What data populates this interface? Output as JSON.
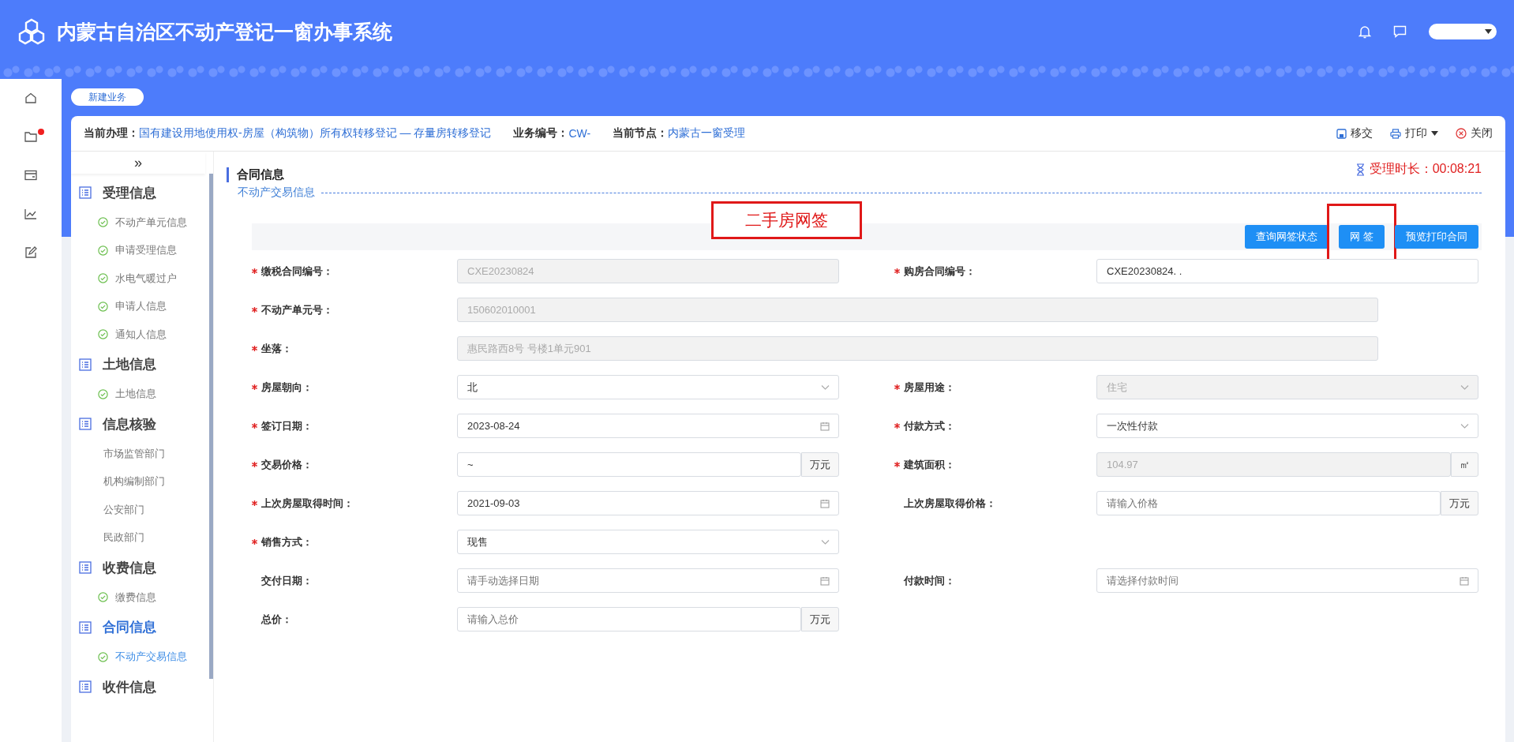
{
  "app": {
    "title": "内蒙古自治区不动产登记一窗办事系统"
  },
  "header_actions": [
    {
      "kind": "bell"
    },
    {
      "kind": "chat"
    }
  ],
  "rail": [
    {
      "kind": "home",
      "badge": false
    },
    {
      "kind": "folder",
      "badge": true
    },
    {
      "kind": "card",
      "badge": false
    },
    {
      "kind": "chart",
      "badge": false
    },
    {
      "kind": "edit",
      "badge": false
    }
  ],
  "page_tab": "新建业务",
  "info_bar": [
    {
      "label": "当前办理：",
      "value": "国有建设用地使用权-房屋（构筑物）所有权转移登记 — 存量房转移登记"
    },
    {
      "label": "业务编号：",
      "value": "CW-"
    },
    {
      "label": "当前节点：",
      "value": "内蒙古一窗受理"
    }
  ],
  "toolbar": [
    {
      "kind": "save",
      "label": "移交"
    },
    {
      "kind": "print",
      "label": "打印",
      "dropdown": true
    },
    {
      "kind": "close",
      "label": "关闭"
    }
  ],
  "nav_toggle": "»",
  "nav": [
    {
      "title": "受理信息",
      "selected": false,
      "items": [
        {
          "label": "不动产单元信息",
          "done": true,
          "selected": false
        },
        {
          "label": "申请受理信息",
          "done": true,
          "selected": false
        },
        {
          "label": "水电气暖过户",
          "done": true,
          "selected": false
        },
        {
          "label": "申请人信息",
          "done": true,
          "selected": false
        },
        {
          "label": "通知人信息",
          "done": true,
          "selected": false
        }
      ]
    },
    {
      "title": "土地信息",
      "selected": false,
      "items": [
        {
          "label": "土地信息",
          "done": true,
          "selected": false
        }
      ]
    },
    {
      "title": "信息核验",
      "selected": false,
      "items": [
        {
          "label": "市场监管部门",
          "done": false,
          "selected": false
        },
        {
          "label": "机构编制部门",
          "done": false,
          "selected": false
        },
        {
          "label": "公安部门",
          "done": false,
          "selected": false
        },
        {
          "label": "民政部门",
          "done": false,
          "selected": false
        }
      ]
    },
    {
      "title": "收费信息",
      "selected": false,
      "items": [
        {
          "label": "缴费信息",
          "done": true,
          "selected": false
        }
      ]
    },
    {
      "title": "合同信息",
      "selected": true,
      "items": [
        {
          "label": "不动产交易信息",
          "done": true,
          "selected": true
        }
      ]
    },
    {
      "title": "收件信息",
      "selected": false
    }
  ],
  "section_title": "合同信息",
  "timer": {
    "label": "受理时长：",
    "value": "00:08:21"
  },
  "subsection": "不动产交易信息",
  "annotation": "二手房网签",
  "buttons": [
    {
      "label": "查询网签状态",
      "highlighted": false
    },
    {
      "label": "网 签",
      "highlighted": true
    },
    {
      "label": "预览打印合同",
      "highlighted": false
    }
  ],
  "rows": [
    [
      {
        "label": "缴税合同编号：",
        "required": true,
        "kind": "text",
        "value": "CXE20230824",
        "disabled": true
      },
      {
        "label": "购房合同编号：",
        "required": true,
        "kind": "text",
        "value": "CXE20230824. .",
        "disabled": false
      }
    ],
    [
      {
        "label": "不动产单元号：",
        "required": true,
        "kind": "wide",
        "value": "150602010001",
        "disabled": true
      }
    ],
    [
      {
        "label": "坐落：",
        "required": true,
        "kind": "wide",
        "value": "惠民路西8号 号楼1单元901",
        "disabled": true
      }
    ],
    [
      {
        "label": "房屋朝向：",
        "required": true,
        "kind": "select",
        "value": "北",
        "disabled": false
      },
      {
        "label": "房屋用途：",
        "required": true,
        "kind": "select",
        "value": "住宅",
        "disabled": true
      }
    ],
    [
      {
        "label": "签订日期：",
        "required": true,
        "kind": "date",
        "value": "2023-08-24",
        "disabled": false
      },
      {
        "label": "付款方式：",
        "required": true,
        "kind": "select",
        "value": "一次性付款",
        "disabled": false
      }
    ],
    [
      {
        "label": "交易价格：",
        "required": true,
        "kind": "unit",
        "value": "~",
        "unit": "万元",
        "disabled": false
      },
      {
        "label": "建筑面积：",
        "required": true,
        "kind": "unit",
        "value": "104.97",
        "unit": "㎡",
        "disabled": true
      }
    ],
    [
      {
        "label": "上次房屋取得时间：",
        "required": true,
        "kind": "date",
        "value": "2021-09-03",
        "disabled": false
      },
      {
        "label": "上次房屋取得价格：",
        "required": false,
        "kind": "unit",
        "placeholder": "请输入价格",
        "unit": "万元",
        "disabled": false
      }
    ],
    [
      {
        "label": "销售方式：",
        "required": true,
        "kind": "select",
        "value": "现售",
        "disabled": false
      }
    ],
    [
      {
        "label": "交付日期：",
        "required": false,
        "kind": "date",
        "placeholder": "请手动选择日期",
        "disabled": false
      },
      {
        "label": "付款时间：",
        "required": false,
        "kind": "date",
        "placeholder": "请选择付款时间",
        "disabled": false
      }
    ],
    [
      {
        "label": "总价：",
        "required": false,
        "kind": "unit",
        "placeholder": "请输入总价",
        "unit": "万元",
        "disabled": false
      }
    ]
  ]
}
